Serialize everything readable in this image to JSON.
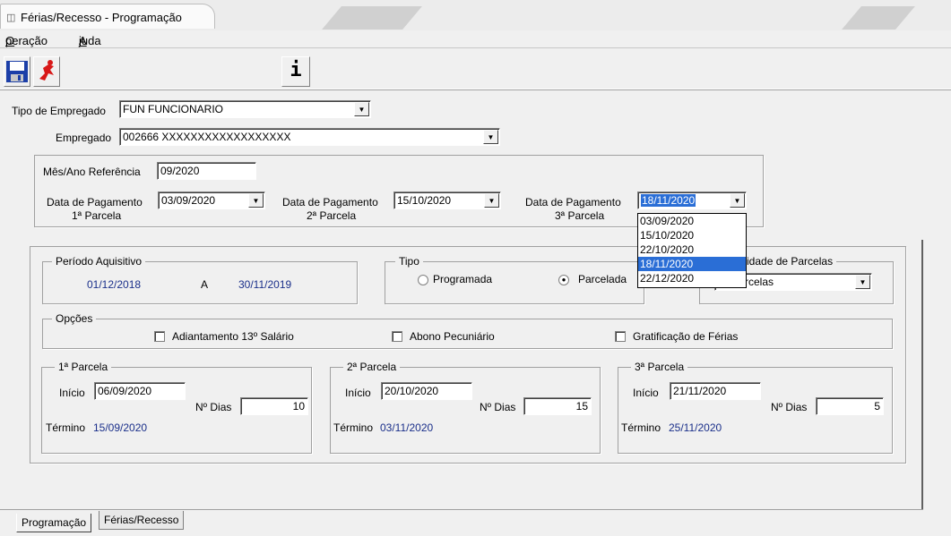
{
  "window": {
    "title": "Férias/Recesso - Programação"
  },
  "menu": {
    "items": [
      "Operação",
      "Ajuda"
    ]
  },
  "toolbar": {
    "info_label": "i"
  },
  "tipo_empregado": {
    "label": "Tipo de Empregado",
    "value": "FUN  FUNCIONARIO"
  },
  "empregado": {
    "label": "Empregado",
    "value": "002666  XXXXXXXXXXXXXXXXXX"
  },
  "referencia": {
    "label": "Mês/Ano Referência",
    "value": "09/2020"
  },
  "pagamento": [
    {
      "label": "Data de Pagamento",
      "sub": "1ª Parcela",
      "value": "03/09/2020"
    },
    {
      "label": "Data de Pagamento",
      "sub": "2ª Parcela",
      "value": "15/10/2020"
    },
    {
      "label": "Data de Pagamento",
      "sub": "3ª Parcela",
      "value": "18/11/2020"
    }
  ],
  "dropdown": {
    "options": [
      "03/09/2020",
      "15/10/2020",
      "22/10/2020",
      "18/11/2020",
      "22/12/2020"
    ],
    "selected": "18/11/2020"
  },
  "periodo": {
    "title": "Período Aquisitivo",
    "start": "01/12/2018",
    "sep": "A",
    "end": "30/11/2019"
  },
  "tipo": {
    "title": "Tipo",
    "option1": "Programada",
    "option2": "Parcelada",
    "selected": "Parcelada"
  },
  "qtd_parcelas": {
    "title_visible": "idade de Parcelas",
    "value_visible": "rcelas"
  },
  "opcoes": {
    "title": "Opções",
    "items": [
      "Adiantamento 13º Salário",
      "Abono Pecuniário",
      "Gratificação de Férias"
    ]
  },
  "parcelas": [
    {
      "title": "1ª Parcela",
      "inicio_label": "Início",
      "inicio": "06/09/2020",
      "dias_label": "Nº Dias",
      "dias": "10",
      "termino_label": "Término",
      "termino": "15/09/2020"
    },
    {
      "title": "2ª Parcela",
      "inicio_label": "Início",
      "inicio": "20/10/2020",
      "dias_label": "Nº Dias",
      "dias": "15",
      "termino_label": "Término",
      "termino": "03/11/2020"
    },
    {
      "title": "3ª Parcela",
      "inicio_label": "Início",
      "inicio": "21/11/2020",
      "dias_label": "Nº Dias",
      "dias": "5",
      "termino_label": "Término",
      "termino": "25/11/2020"
    }
  ],
  "tabs": [
    "Programação",
    "Férias/Recesso"
  ]
}
